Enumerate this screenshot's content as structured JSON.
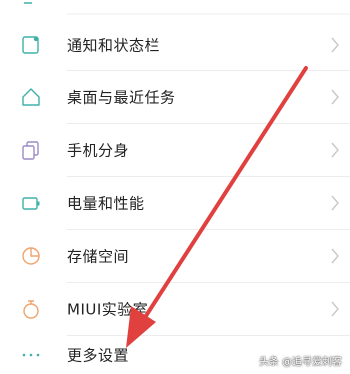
{
  "settings_list": {
    "items": [
      {
        "label": "通知和状态栏",
        "icon": "notification-icon"
      },
      {
        "label": "桌面与最近任务",
        "icon": "home-icon"
      },
      {
        "label": "手机分身",
        "icon": "second-space-icon"
      },
      {
        "label": "电量和性能",
        "icon": "battery-icon"
      },
      {
        "label": "存储空间",
        "icon": "storage-pie-icon"
      },
      {
        "label": "MIUI实验室",
        "icon": "lab-flask-icon"
      },
      {
        "label": "更多设置",
        "icon": "more-dots-icon"
      }
    ]
  },
  "annotation": {
    "arrow_color": "#e0413f",
    "points_to": "更多设置"
  },
  "watermark": {
    "text": "头条 @追寻爱刺客"
  },
  "colors": {
    "icon_teal": "#3fb0a8",
    "icon_purple": "#9b8cc4",
    "icon_orange": "#f0a36b",
    "chevron": "#c8c8c8"
  }
}
